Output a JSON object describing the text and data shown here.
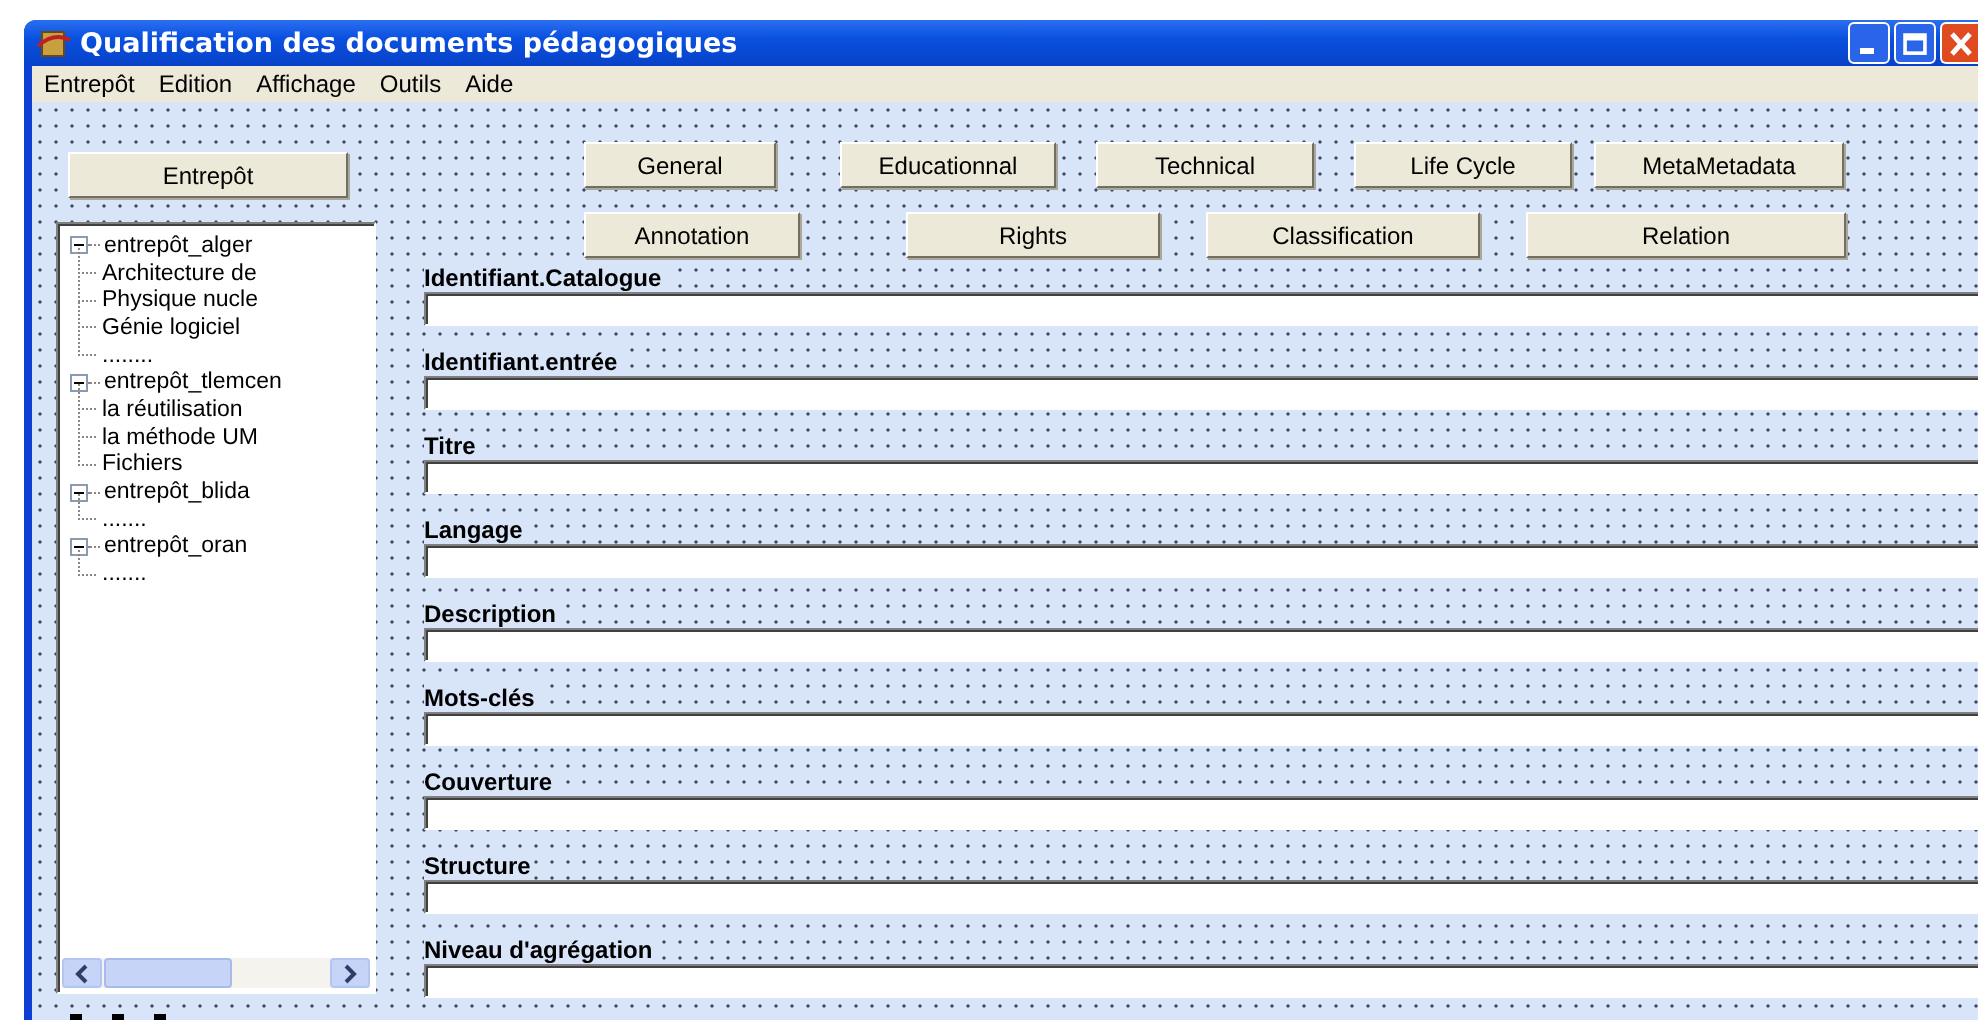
{
  "window": {
    "title": "Qualification des documents pédagogiques"
  },
  "menu": [
    "Entrepôt",
    "Edition",
    "Affichage",
    "Outils",
    "Aide"
  ],
  "side_button": "Entrepôt",
  "tree": [
    {
      "label": "entrepôt_alger",
      "expanded": true,
      "children": [
        {
          "label": "Architecture de"
        },
        {
          "label": "Physique nucle"
        },
        {
          "label": "Génie logiciel"
        },
        {
          "label": "........"
        }
      ]
    },
    {
      "label": "entrepôt_tlemcen",
      "expanded": true,
      "children": [
        {
          "label": "la réutilisation"
        },
        {
          "label": "la méthode UM"
        },
        {
          "label": "Fichiers"
        }
      ]
    },
    {
      "label": "entrepôt_blida",
      "expanded": true,
      "children": [
        {
          "label": "......."
        }
      ]
    },
    {
      "label": "entrepôt_oran",
      "expanded": true,
      "children": [
        {
          "label": "......."
        }
      ]
    }
  ],
  "button_rows": [
    [
      "General",
      "Educationnal",
      "Technical",
      "Life Cycle",
      "MetaMetadata"
    ],
    [
      "Annotation",
      "Rights",
      "Classification",
      "Relation"
    ]
  ],
  "fields": [
    {
      "label": "Identifiant.Catalogue"
    },
    {
      "label": "Identifiant.entrée"
    },
    {
      "label": "Titre"
    },
    {
      "label": "Langage"
    },
    {
      "label": "Description"
    },
    {
      "label": "Mots-clés"
    },
    {
      "label": "Couverture"
    },
    {
      "label": "Structure"
    },
    {
      "label": "Niveau d'agrégation"
    }
  ]
}
